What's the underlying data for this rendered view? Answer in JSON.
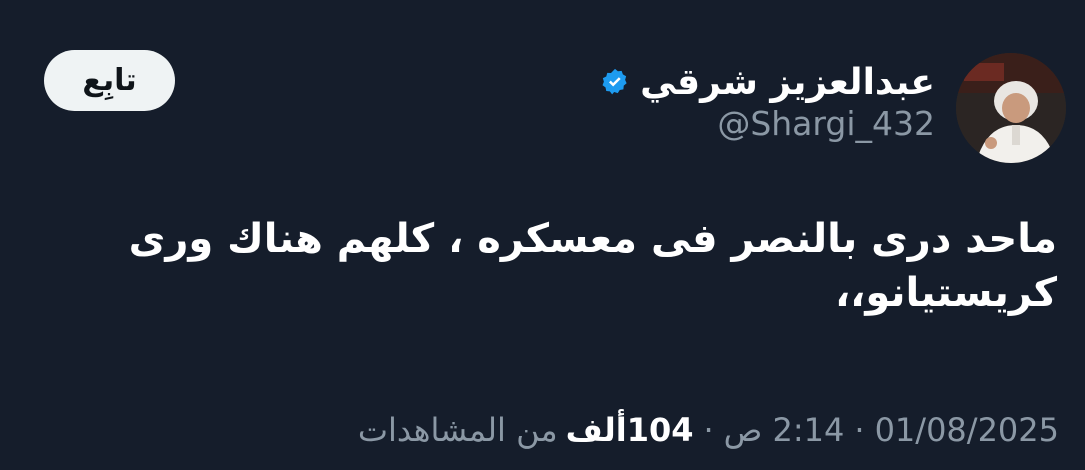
{
  "author": {
    "display_name": "عبدالعزيز شرقي",
    "handle": "@Shargi_432",
    "verified_color": "#1d9bf0"
  },
  "follow_button": {
    "label": "تابِع"
  },
  "tweet": {
    "lines": [
      "ماحد درى بالنصر فى معسكره ، كلهم هناك ورى",
      "كريستيانو،،"
    ]
  },
  "meta": {
    "date": "01/08/2025",
    "separator": "·",
    "time": "2:14 ص",
    "views_count": "104ألف",
    "views_label": "من المشاهدات"
  },
  "colors": {
    "background": "#151d2b",
    "muted_text": "#8b98a5",
    "button_bg": "#eff3f4"
  }
}
